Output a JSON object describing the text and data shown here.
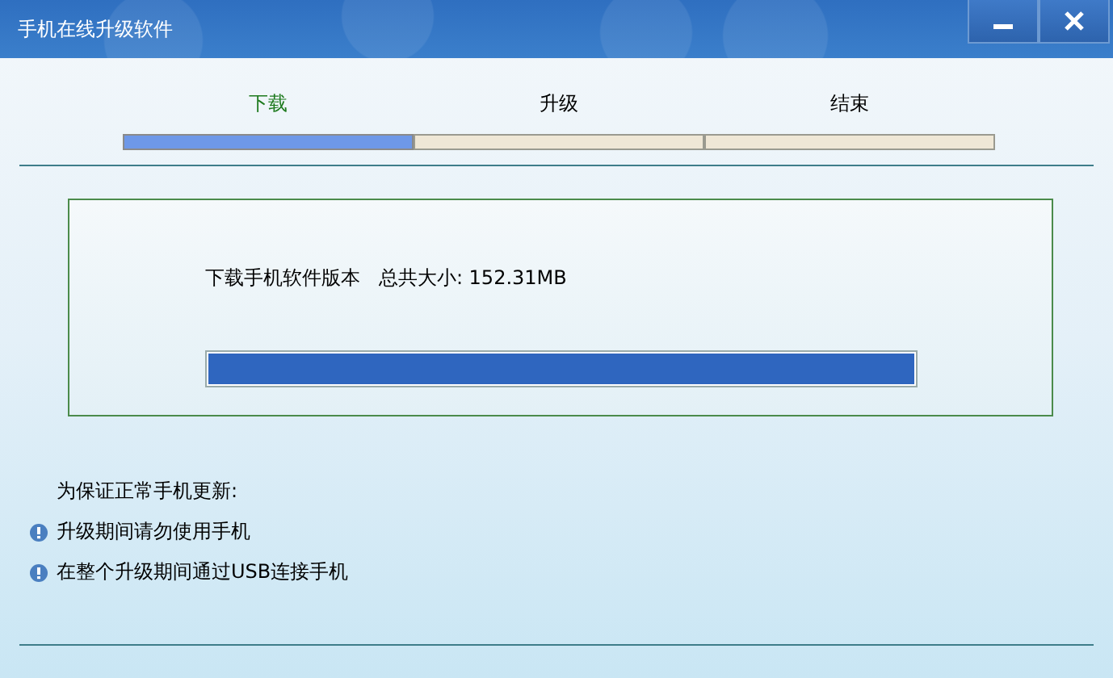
{
  "window": {
    "title": "手机在线升级软件"
  },
  "steps": [
    {
      "label": "下载",
      "selected": true
    },
    {
      "label": "升级",
      "selected": false
    },
    {
      "label": "结束",
      "selected": false
    }
  ],
  "download": {
    "message": "下载手机软件版本   总共大小: 152.31MB",
    "level": 1
  },
  "notes": {
    "heading": "为保证正常手机更新:",
    "items": [
      "升级期间请勿使用手机",
      "在整个升级期间通过USB连接手机"
    ]
  }
}
